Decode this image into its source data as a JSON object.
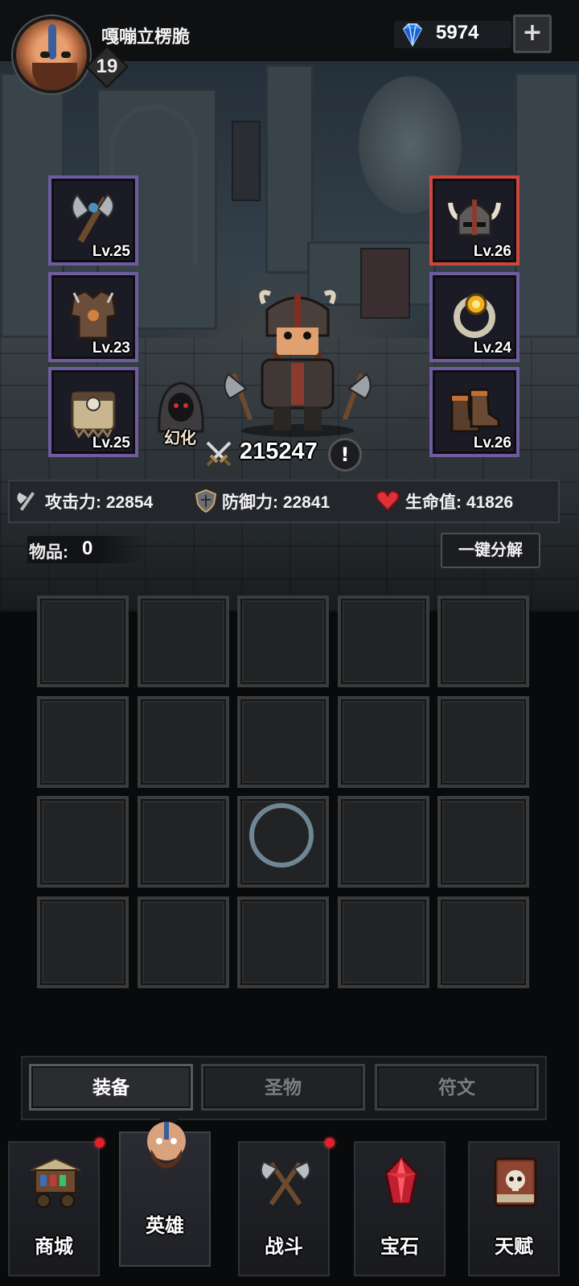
{
  "player": {
    "name": "嘎嘣立楞脆",
    "level": "19"
  },
  "currency": {
    "gems": "5974",
    "add_label": "+"
  },
  "equipment": {
    "left": [
      {
        "name": "axe",
        "level": "Lv.25"
      },
      {
        "name": "armor",
        "level": "Lv.23"
      },
      {
        "name": "belt",
        "level": "Lv.25"
      }
    ],
    "right": [
      {
        "name": "helmet",
        "level": "Lv.26",
        "selected": true
      },
      {
        "name": "ring",
        "level": "Lv.24"
      },
      {
        "name": "boots",
        "level": "Lv.26"
      }
    ]
  },
  "hero": {
    "transform_label": "幻化",
    "power": "215247",
    "info_label": "!"
  },
  "stats": {
    "attack": "攻击力: 22854",
    "defense": "防御力: 22841",
    "hp": "生命值: 41826"
  },
  "inventory": {
    "label": "物品:",
    "count": "0",
    "dismantle_label": "一键分解",
    "rows": 4,
    "columns": 5,
    "loading": true
  },
  "subtabs": [
    {
      "label": "装备",
      "active": true
    },
    {
      "label": "圣物",
      "active": false
    },
    {
      "label": "符文",
      "active": false
    }
  ],
  "nav": [
    {
      "label": "商城",
      "icon": "shop-cart-icon",
      "badge": true
    },
    {
      "label": "英雄",
      "icon": "hero-portrait-icon",
      "badge": false,
      "active": true
    },
    {
      "label": "战斗",
      "icon": "crossed-axes-icon",
      "badge": true
    },
    {
      "label": "宝石",
      "icon": "red-crystal-icon",
      "badge": false
    },
    {
      "label": "天赋",
      "icon": "skull-book-icon",
      "badge": false
    }
  ],
  "colors": {
    "slot_border": "#6e5ba0",
    "selected_border": "#d0463d",
    "badge_red": "#e0202a",
    "gem_blue": "#2f7df0"
  }
}
